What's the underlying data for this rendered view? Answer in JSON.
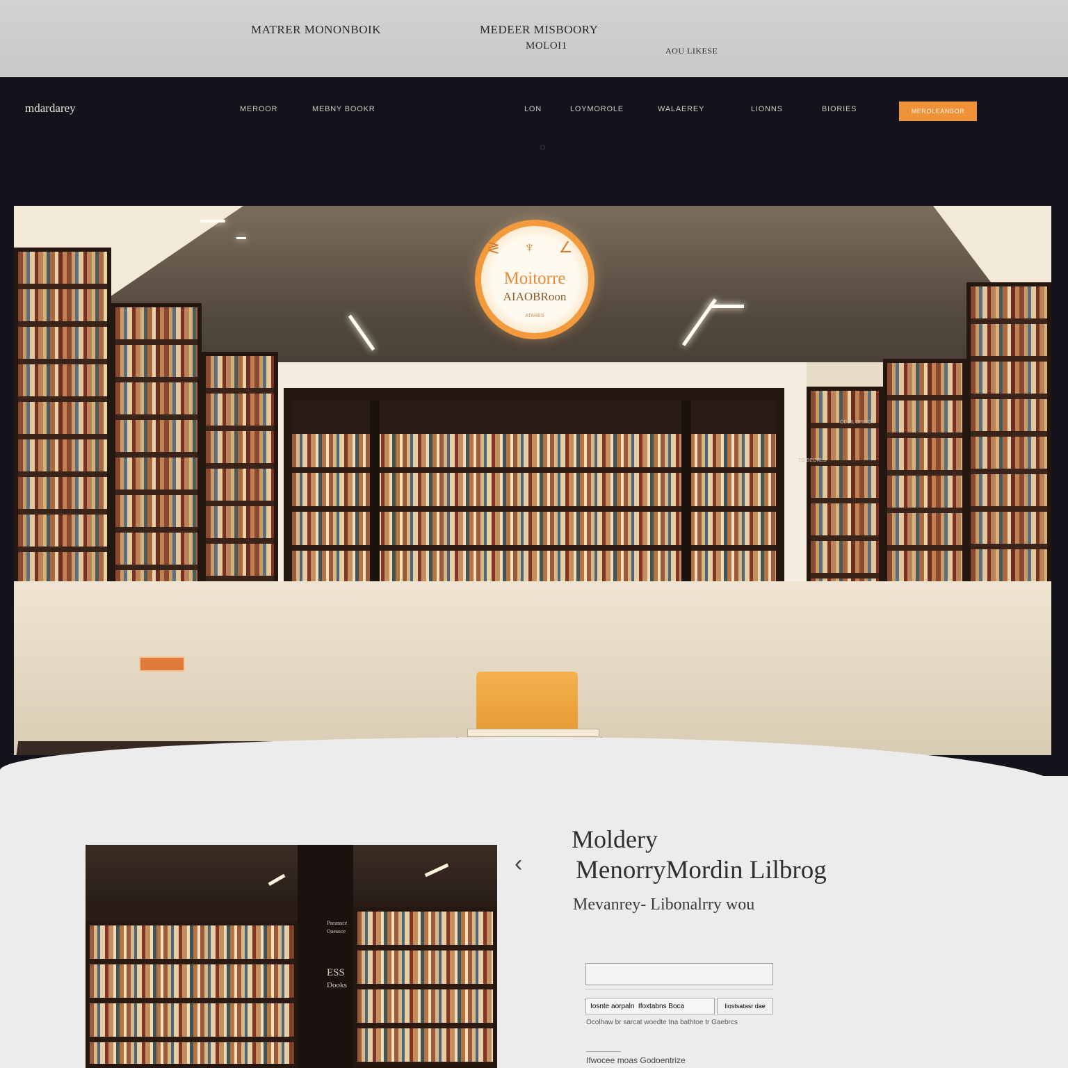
{
  "top_banner": {
    "left_title": "MATRER MONONBOIK",
    "center_title": "MEDEER MISBOORY",
    "center_subtitle": "MOLOI1",
    "right_label": "AOU LIKESE"
  },
  "nav": {
    "brand": "mdardarey",
    "links": [
      "MEROOR",
      "MEBNY  BOOKR",
      "LON",
      "LOYMOROLE",
      "WALAEREY",
      "LIONNS",
      "BIORIES"
    ],
    "cta_label": "MEROLEANBOR"
  },
  "hero": {
    "logo_main": "Moitorre",
    "logo_sub": "AIAOBRoon",
    "logo_tiny": "ATARES",
    "logo_mark": "≷ ♆ ∠",
    "wall_sign_right": "ODBIL DFIMON",
    "wall_sign_right_2": "TO BEORES"
  },
  "lower": {
    "pillar_text_1": "Paeansce",
    "pillar_text_2": "Oaeusce",
    "pillar_text_3": "ESS",
    "pillar_text_4": "Dooks",
    "title": "Moldery",
    "subtitle": "MenorryMordin Lilbrog",
    "tagline": "Mevanrey- Libonalrry wou",
    "field_main_value": "",
    "field_row_value": "Iosnte aorpaln  Ifoxtabns Boca",
    "field_button_label": "Iiostsatasr dae",
    "field_hint": "Ocolhaw  br sarcat  woedte  Ina  bathtoe  tr  Gaebrcs",
    "footer_note": "Ifwocee  moas  Godoentrize"
  },
  "colors": {
    "accent": "#f0923a",
    "hero_bg": "#14121a",
    "banner_bg": "#cdcdcd",
    "page_bg": "#ececec"
  },
  "icons": {
    "spinner": "loading-spinner-icon",
    "arrow": "chevron-left-icon"
  }
}
